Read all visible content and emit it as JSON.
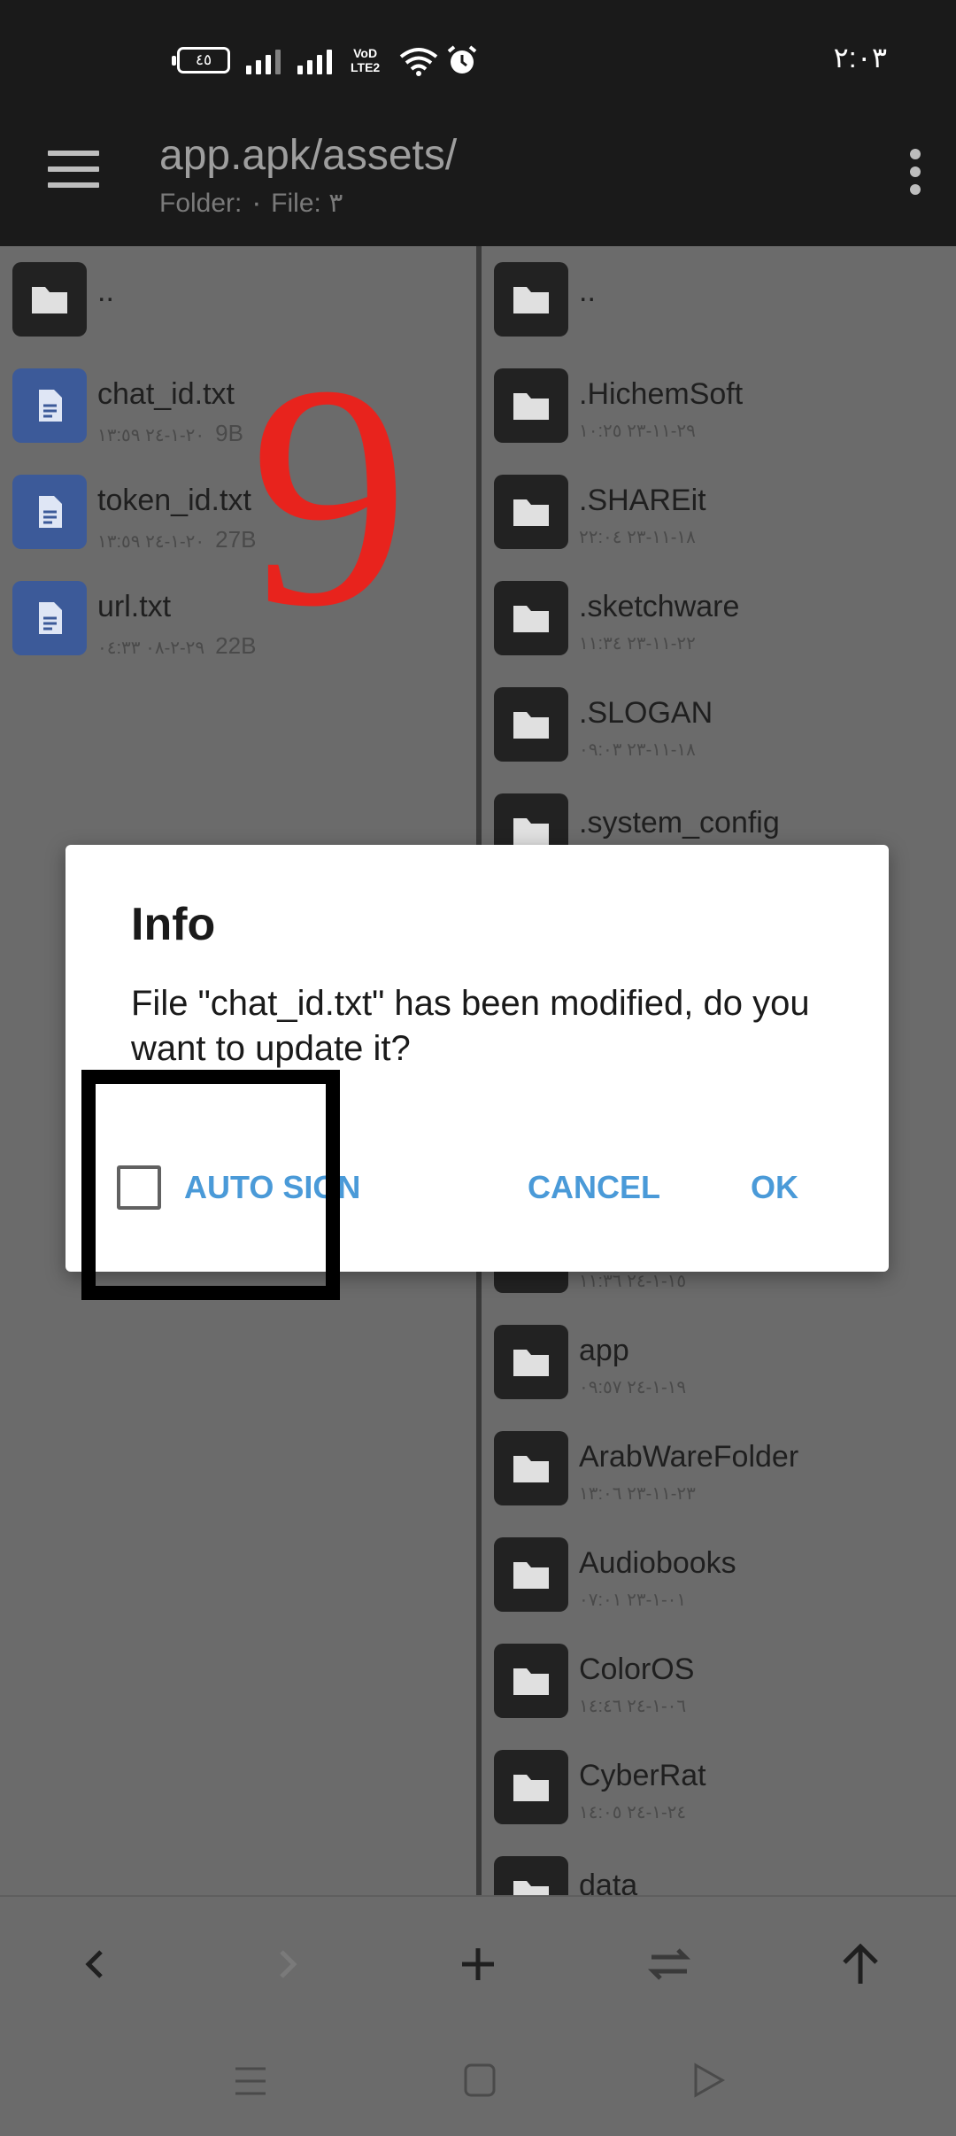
{
  "status_bar": {
    "battery": "٤٥",
    "volte_line1": "VoD",
    "volte_line2": "LTE2",
    "time": "٢:٠٣"
  },
  "toolbar": {
    "title": "app.apk/assets/",
    "subtitle": "Folder: ٠  File: ٣"
  },
  "left_pane": [
    {
      "type": "folder",
      "name": "..",
      "date": "",
      "size": ""
    },
    {
      "type": "file",
      "name": "chat_id.txt",
      "date": "٢٠-١-٢٤ ١٣:٥٩",
      "size": "9B"
    },
    {
      "type": "file",
      "name": "token_id.txt",
      "date": "٢٠-١-٢٤ ١٣:٥٩",
      "size": "27B"
    },
    {
      "type": "file",
      "name": "url.txt",
      "date": "٢٩-٢-٠٨ ٠٤:٣٣",
      "size": "22B"
    }
  ],
  "annotation_number": "9",
  "right_pane": [
    {
      "type": "folder",
      "name": "..",
      "date": ""
    },
    {
      "type": "folder",
      "name": ".HichemSoft",
      "date": "٢٩-١١-٢٣ ١٠:٢٥"
    },
    {
      "type": "folder",
      "name": ".SHAREit",
      "date": "١٨-١١-٢٣ ٢٢:٠٤"
    },
    {
      "type": "folder",
      "name": ".sketchware",
      "date": "٢٢-١١-٢٣ ١١:٣٤"
    },
    {
      "type": "folder",
      "name": ".SLOGAN",
      "date": "١٨-١١-٢٣ ٠٩:٠٣"
    },
    {
      "type": "folder",
      "name": ".system_config",
      "date": ""
    },
    {
      "type": "folder",
      "name": "",
      "date": ""
    },
    {
      "type": "folder",
      "name": "",
      "date": ""
    },
    {
      "type": "folder",
      "name": "",
      "date": ""
    },
    {
      "type": "folder",
      "name": "",
      "date": "١٥-١-٢٤ ١١:٣٦"
    },
    {
      "type": "folder",
      "name": "app",
      "date": "١٩-١-٢٤ ٠٩:٥٧"
    },
    {
      "type": "folder",
      "name": "ArabWareFolder",
      "date": "٢٣-١١-٢٣ ١٣:٠٦"
    },
    {
      "type": "folder",
      "name": "Audiobooks",
      "date": "٠١-١-٢٣ ٠٧:٠١"
    },
    {
      "type": "folder",
      "name": "ColorOS",
      "date": "٠٦-١-٢٤ ١٤:٤٦"
    },
    {
      "type": "folder",
      "name": "CyberRat",
      "date": "٢٤-١-٢٤ ١٤:٠٥"
    },
    {
      "type": "folder",
      "name": "data",
      "date": ""
    }
  ],
  "dialog": {
    "title": "Info",
    "message": "File \"chat_id.txt\" has been modified, do you want to update it?",
    "checkbox_label": "AUTO SIGN",
    "cancel": "CANCEL",
    "ok": "OK"
  },
  "colors": {
    "accent": "#4a9ad8",
    "annotation": "#e8231d",
    "file_tile": "#3c5a99"
  }
}
